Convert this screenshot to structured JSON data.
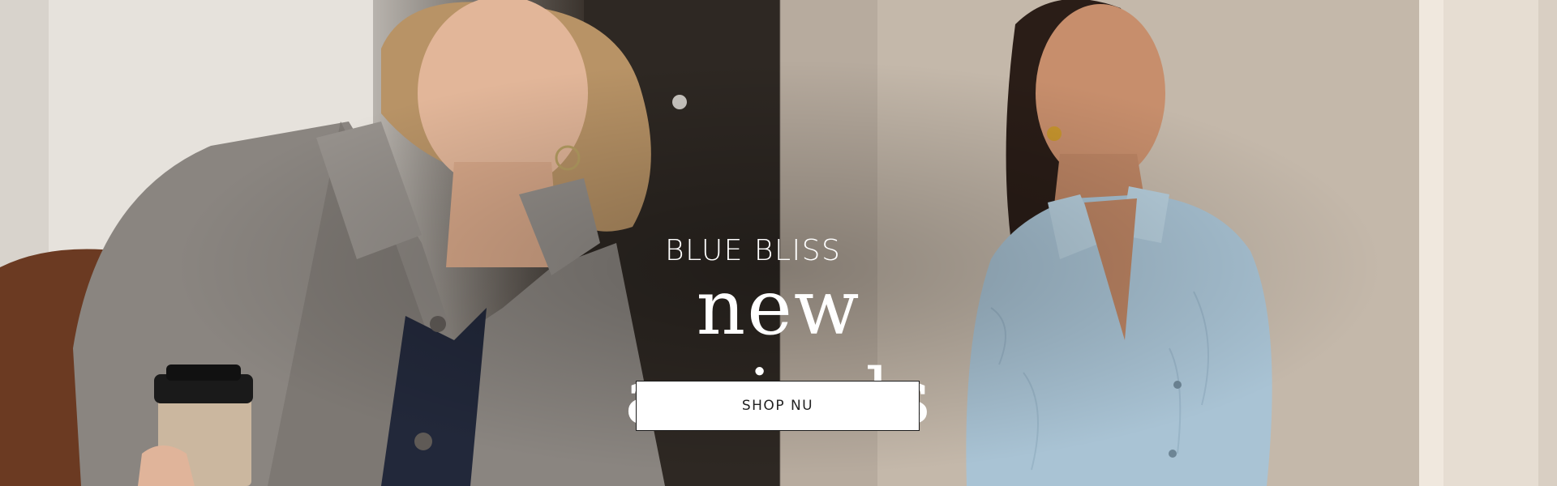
{
  "hero": {
    "eyebrow": "BLUE BLISS",
    "title": "new arrivals",
    "cta_label": "SHOP NU"
  },
  "images": {
    "left": "model in grey tweed jacket holding coffee cup",
    "right": "model in light blue crinkle shirt"
  },
  "colors": {
    "text": "#ffffff",
    "button_bg": "#ffffff",
    "button_text": "#222222",
    "shirt_blue": "#a9c3d4",
    "jacket_grey": "#8a8580"
  }
}
